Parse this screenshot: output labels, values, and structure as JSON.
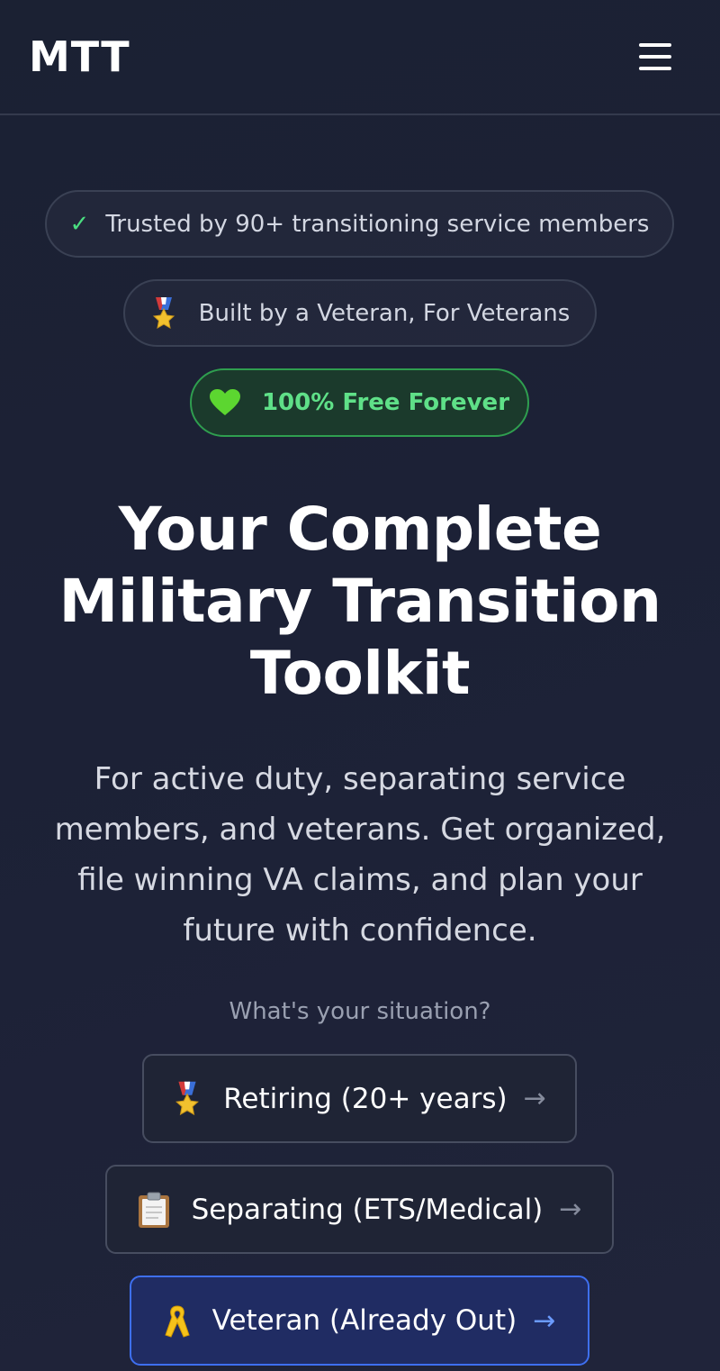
{
  "header": {
    "logo": "MTT",
    "menu_icon": "hamburger-menu-icon"
  },
  "badges": {
    "trusted": {
      "check": "✓",
      "text": "Trusted by 90+ transitioning service members"
    },
    "veteran": {
      "emoji": "🎖️",
      "text": "Built by a Veteran, For Veterans"
    },
    "free": {
      "emoji": "💚",
      "text": "100% Free Forever"
    }
  },
  "hero": {
    "title_lines": [
      "Your Complete",
      "Military Transition",
      "Toolkit"
    ],
    "subtitle_lines": [
      "For active duty, separating service",
      "members, and veterans. Get organized,",
      "file winning VA claims, and plan your",
      "future with confidence."
    ]
  },
  "situation": {
    "label": "What's your situation?",
    "options": [
      {
        "emoji": "🎖️",
        "label": "Retiring (20+ years)",
        "arrow": "→"
      },
      {
        "emoji": "📋",
        "label": "Separating (ETS/Medical)",
        "arrow": "→"
      },
      {
        "emoji": "🎗️",
        "label": "Veteran (Already Out)",
        "arrow": "→",
        "selected": true
      }
    ]
  },
  "colors": {
    "background": "#1c2136",
    "accent_green": "#4ade80",
    "accent_blue": "#3e6ff0",
    "text_muted": "#9aa0b1"
  }
}
